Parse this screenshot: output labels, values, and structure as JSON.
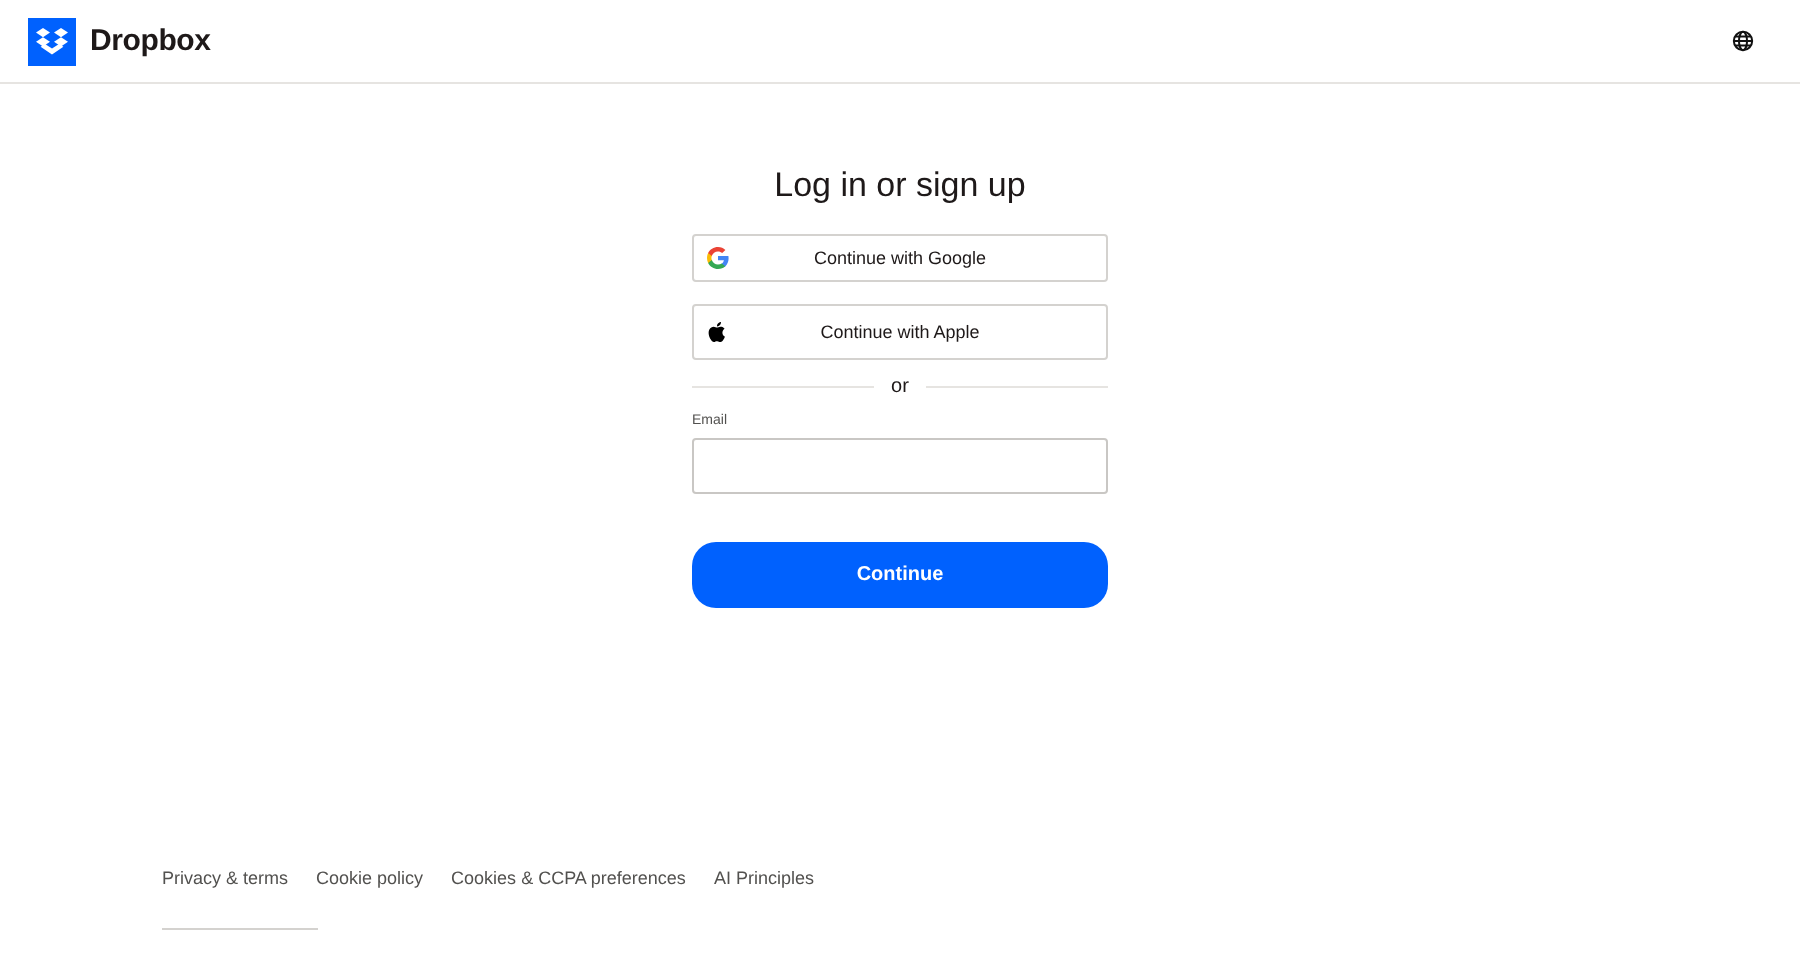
{
  "header": {
    "brand": "Dropbox"
  },
  "login": {
    "title": "Log in or sign up",
    "providers": [
      {
        "kind": "google",
        "label": "Continue with Google"
      },
      {
        "kind": "apple",
        "label": "Continue with Apple"
      }
    ],
    "divider": "or",
    "email_label": "Email",
    "submit": "Continue"
  },
  "footer": {
    "links": [
      "Privacy & terms",
      "Cookie policy",
      "Cookies & CCPA preferences",
      "AI Principles"
    ]
  }
}
